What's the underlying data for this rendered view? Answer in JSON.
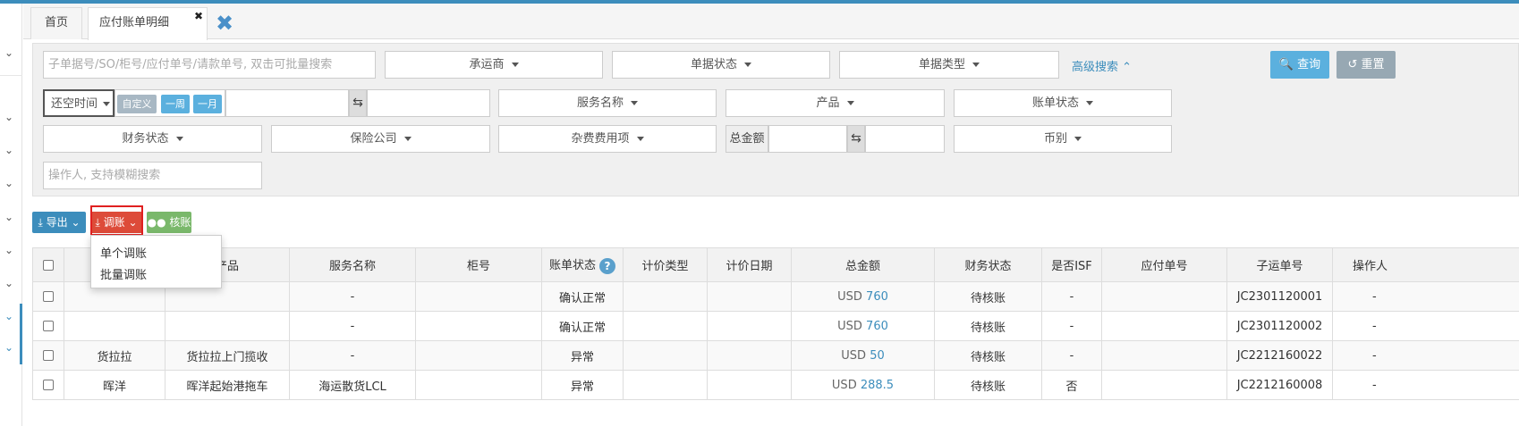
{
  "tabs": {
    "home": "首页",
    "active": "应付账单明细",
    "active_close": "✖",
    "close_all": "✖"
  },
  "colors": {
    "accent": "#3c8dbc",
    "danger": "#dd4b39",
    "success": "#7ab86b"
  },
  "filters": {
    "search_placeholder": "子单据号/SO/柜号/应付单号/请款单号, 双击可批量搜索",
    "carrier": "承运商",
    "doc_status": "单据状态",
    "doc_type": "单据类型",
    "advanced": "高级搜索",
    "query": "查询",
    "reset": "重置",
    "time_select": "还空时间",
    "custom": "自定义",
    "week": "一周",
    "month": "一月",
    "service_name": "服务名称",
    "product": "产品",
    "bill_status": "账单状态",
    "finance_status": "财务状态",
    "insurance": "保险公司",
    "misc_fee": "杂费费用项",
    "total_amount": "总金额",
    "currency": "币别",
    "operator_placeholder": "操作人, 支持模糊搜索"
  },
  "actions": {
    "export": "导出",
    "adjust": "调账",
    "check": "核账",
    "menu_single": "单个调账",
    "menu_batch": "批量调账"
  },
  "table": {
    "headers": [
      "",
      "",
      "产品",
      "服务名称",
      "柜号",
      "账单状态",
      "计价类型",
      "计价日期",
      "总金额",
      "财务状态",
      "是否ISF",
      "应付单号",
      "子运单号",
      "操作人"
    ],
    "rows": [
      {
        "carrier": "",
        "product": "",
        "service": "-",
        "container": "",
        "status": "确认正常",
        "pricing_type": "",
        "pricing_date": "",
        "currency": "USD",
        "amount": "760",
        "finance": "待核账",
        "isf": "-",
        "payable_no": "",
        "sub_no": "JC2301120001",
        "sub_link": false,
        "operator": "-"
      },
      {
        "carrier": "",
        "product": "",
        "service": "-",
        "container": "",
        "status": "确认正常",
        "pricing_type": "",
        "pricing_date": "",
        "currency": "USD",
        "amount": "760",
        "finance": "待核账",
        "isf": "-",
        "payable_no": "",
        "sub_no": "JC2301120002",
        "sub_link": false,
        "operator": "-"
      },
      {
        "carrier": "货拉拉",
        "product": "货拉拉上门揽收",
        "service": "-",
        "container": "",
        "status": "异常",
        "pricing_type": "",
        "pricing_date": "",
        "currency": "USD",
        "amount": "50",
        "finance": "待核账",
        "isf": "-",
        "payable_no": "",
        "sub_no": "JC2212160022",
        "sub_link": false,
        "operator": "-"
      },
      {
        "carrier": "晖洋",
        "product": "晖洋起始港拖车",
        "service": "海运散货LCL",
        "container": "",
        "status": "异常",
        "pricing_type": "",
        "pricing_date": "",
        "currency": "USD",
        "amount": "288.5",
        "finance": "待核账",
        "isf": "否",
        "payable_no": "",
        "sub_no": "JC2212160008",
        "sub_link": true,
        "operator": "-"
      }
    ]
  }
}
